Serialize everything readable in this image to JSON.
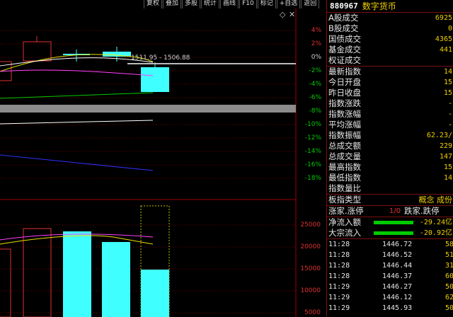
{
  "toolbar": {
    "buttons": [
      "复权",
      "叠加",
      "多股",
      "统计",
      "画线",
      "F10",
      "标记",
      "+自选",
      "返回"
    ]
  },
  "chart": {
    "price_axis": [
      "4%",
      "2%",
      "0%",
      "-2%",
      "-4%",
      "-6%",
      "-8%",
      "-10%",
      "-12%",
      "-14%",
      "-16%",
      "-18%"
    ],
    "volume_axis": [
      "25000",
      "20000",
      "15000",
      "10000",
      "5000"
    ],
    "range_label": "1511.95 - 1506.88",
    "colors": {
      "up": "#e03030",
      "down": "#40ffff",
      "ma5": "#ffffff",
      "ma10": "#e8e000",
      "ma20": "#ff40ff",
      "ma60": "#00cc00",
      "ma120": "#3030ff",
      "grid": "#800000"
    }
  },
  "panel": {
    "code": "880967",
    "name": "数字货币",
    "stats": [
      {
        "label": "A股成交",
        "value": "6925"
      },
      {
        "label": "B股成交",
        "value": "0"
      },
      {
        "label": "国债成交",
        "value": "4365"
      },
      {
        "label": "基金成交",
        "value": "441"
      },
      {
        "label": "权证成交",
        "value": ""
      }
    ],
    "index": [
      {
        "label": "最新指数",
        "value": "14"
      },
      {
        "label": "今日开盘",
        "value": "15"
      },
      {
        "label": "昨日收盘",
        "value": "15"
      },
      {
        "label": "指数涨跌",
        "value": "-"
      },
      {
        "label": "指数涨幅",
        "value": "-"
      },
      {
        "label": "平均涨幅",
        "value": "-"
      },
      {
        "label": "指数振幅",
        "value": "62.23/"
      },
      {
        "label": "总成交额",
        "value": "229"
      },
      {
        "label": "总成交量",
        "value": "147"
      },
      {
        "label": "最高指数",
        "value": "15"
      },
      {
        "label": "最低指数",
        "value": "14"
      },
      {
        "label": "指数量比",
        "value": ""
      }
    ],
    "category": {
      "label": "板指类型",
      "value": "概念 成份"
    },
    "updown": {
      "label": "涨家.涨停",
      "ratio": "1/0",
      "label2": "跌家.跌停"
    },
    "flows": [
      {
        "label": "净流入额",
        "value": "-29.24亿"
      },
      {
        "label": "大宗流入",
        "value": "-20.92亿"
      }
    ],
    "ticks": [
      {
        "time": "11:28",
        "price": "1446.72",
        "vol": "58"
      },
      {
        "time": "11:28",
        "price": "1446.52",
        "vol": "51"
      },
      {
        "time": "11:28",
        "price": "1446.44",
        "vol": "31"
      },
      {
        "time": "11:28",
        "price": "1446.37",
        "vol": "60"
      },
      {
        "time": "11:29",
        "price": "1446.27",
        "vol": "50"
      },
      {
        "time": "11:29",
        "price": "1446.12",
        "vol": "62"
      },
      {
        "time": "11:29",
        "price": "1445.93",
        "vol": "50"
      }
    ]
  }
}
